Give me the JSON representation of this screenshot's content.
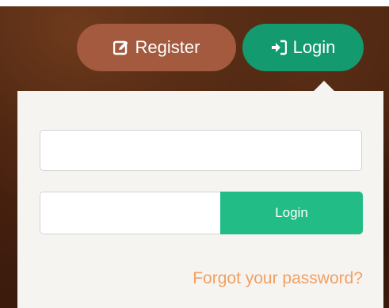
{
  "header": {
    "register_label": "Register",
    "register_icon": "edit-icon",
    "login_label": "Login",
    "login_icon": "sign-in-icon"
  },
  "login_panel": {
    "username": {
      "value": "",
      "placeholder": ""
    },
    "password": {
      "value": "",
      "placeholder": ""
    },
    "submit_label": "Login",
    "forgot_label": "Forgot your password?"
  },
  "colors": {
    "register_button": "#a35a3e",
    "login_button": "#139a6e",
    "submit_button": "#22bd86",
    "forgot_link": "#f2a064",
    "panel_bg": "#f6f4f0"
  }
}
